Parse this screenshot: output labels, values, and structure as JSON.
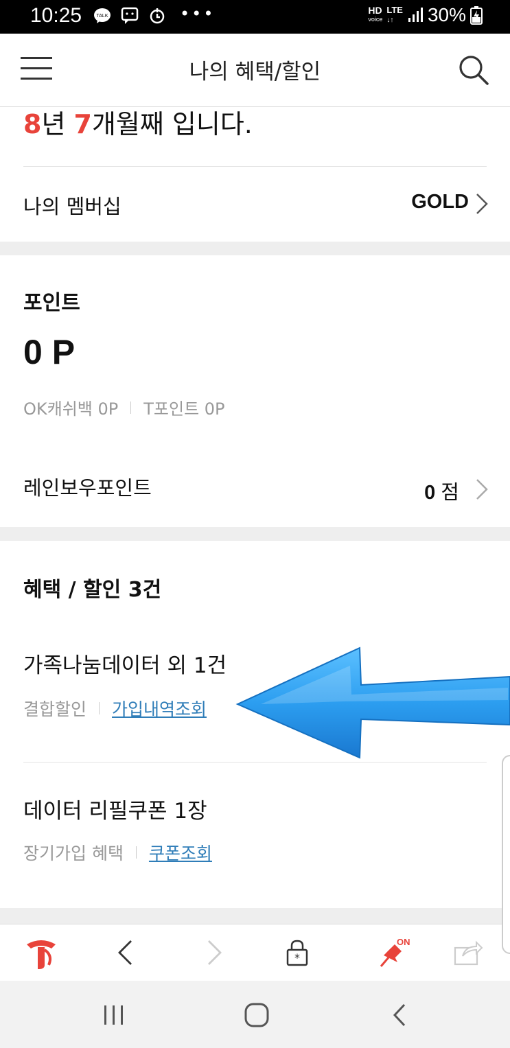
{
  "status_bar": {
    "time": "10:25",
    "hd": "HD",
    "hd_sub": "voice",
    "network": "LTE",
    "battery": "30%"
  },
  "header": {
    "title": "나의 혜택/할인",
    "menu_icon": "hamburger-menu-icon",
    "search_icon": "search-icon"
  },
  "tenure": {
    "years": "8",
    "years_unit": "년 ",
    "months": "7",
    "suffix": "개월째 입니다."
  },
  "membership": {
    "label": "나의 멤버십",
    "value": "GOLD"
  },
  "points": {
    "title": "포인트",
    "total": "0 P",
    "ok_cashbag": "OK캐쉬백 0P",
    "t_point": "T포인트 0P",
    "rainbow_label": "레인보우포인트",
    "rainbow_value": "0",
    "rainbow_unit": " 점"
  },
  "benefits": {
    "title": "혜택 / 할인 3건",
    "items": [
      {
        "title": "가족나눔데이터 외 1건",
        "category": "결합할인",
        "link": "가입내역조회"
      },
      {
        "title": "데이터 리필쿠폰 1장",
        "category": "장기가입 혜택",
        "link": "쿠폰조회"
      }
    ]
  },
  "toolbar": {
    "on_label": "ON",
    "icons": [
      "t-logo-icon",
      "back-icon",
      "forward-icon",
      "lock-icon",
      "pin-icon",
      "share-icon"
    ]
  },
  "navbar": {
    "icons": [
      "recent-apps-icon",
      "home-icon",
      "back-icon"
    ]
  },
  "colors": {
    "accent_red": "#e8433a",
    "link_blue": "#2f7db8",
    "arrow_blue": "#2c9ef0"
  }
}
